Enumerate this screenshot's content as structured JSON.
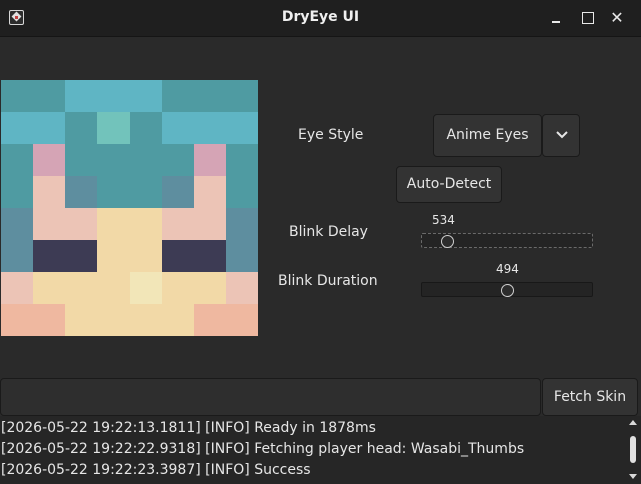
{
  "window": {
    "title": "DryEye UI"
  },
  "skin_preview": {
    "rows": [
      [
        "#4f9ba2",
        "#4f9ba2",
        "#5fb5c4",
        "#5fb5c4",
        "#5fb5c4",
        "#4f9ba2",
        "#4f9ba2",
        "#4f9ba2"
      ],
      [
        "#5fb5c4",
        "#5fb5c4",
        "#4f9ba2",
        "#72c3bb",
        "#4f9ba2",
        "#5fb5c4",
        "#5fb5c4",
        "#5fb5c4"
      ],
      [
        "#4f9ba2",
        "#d5a4b5",
        "#4f9ba2",
        "#4f9ba2",
        "#4f9ba2",
        "#4f9ba2",
        "#d5a4b5",
        "#4f9ba2"
      ],
      [
        "#4f9ba2",
        "#ecc4b6",
        "#5e8e9f",
        "#4f9ba2",
        "#4f9ba2",
        "#5e8e9f",
        "#ecc4b6",
        "#4f9ba2"
      ],
      [
        "#5e8e9f",
        "#ecc4b6",
        "#ecc4b6",
        "#f2d9a7",
        "#f2d9a7",
        "#ecc4b6",
        "#ecc4b6",
        "#5e8e9f"
      ],
      [
        "#5e8e9f",
        "#3d3b54",
        "#3d3b54",
        "#f2d9a7",
        "#f2d9a7",
        "#3d3b54",
        "#3d3b54",
        "#5e8e9f"
      ],
      [
        "#ecc4b6",
        "#f2d9a7",
        "#f2d9a7",
        "#f2d9a7",
        "#f2e6b8",
        "#f2d9a7",
        "#f2d9a7",
        "#ecc4b6"
      ],
      [
        "#efb8a0",
        "#efb8a0",
        "#f2d9a7",
        "#f2d9a7",
        "#f2d9a7",
        "#f2d9a7",
        "#efb8a0",
        "#efb8a0"
      ]
    ]
  },
  "controls": {
    "eye_style_label": "Eye Style",
    "eye_style_value": "Anime Eyes",
    "auto_detect_label": "Auto-Detect",
    "blink_delay_label": "Blink Delay",
    "blink_delay_value": "534",
    "blink_delay_fraction": 0.12,
    "blink_duration_label": "Blink Duration",
    "blink_duration_value": "494",
    "blink_duration_fraction": 0.5
  },
  "fetch": {
    "input_value": "",
    "button_label": "Fetch Skin"
  },
  "log": [
    "[2026-05-22 19:22:13.1811] [INFO] Ready in 1878ms",
    "[2026-05-22 19:22:22.9318] [INFO] Fetching player head: Wasabi_Thumbs",
    "[2026-05-22 19:22:23.3987] [INFO] Success"
  ]
}
